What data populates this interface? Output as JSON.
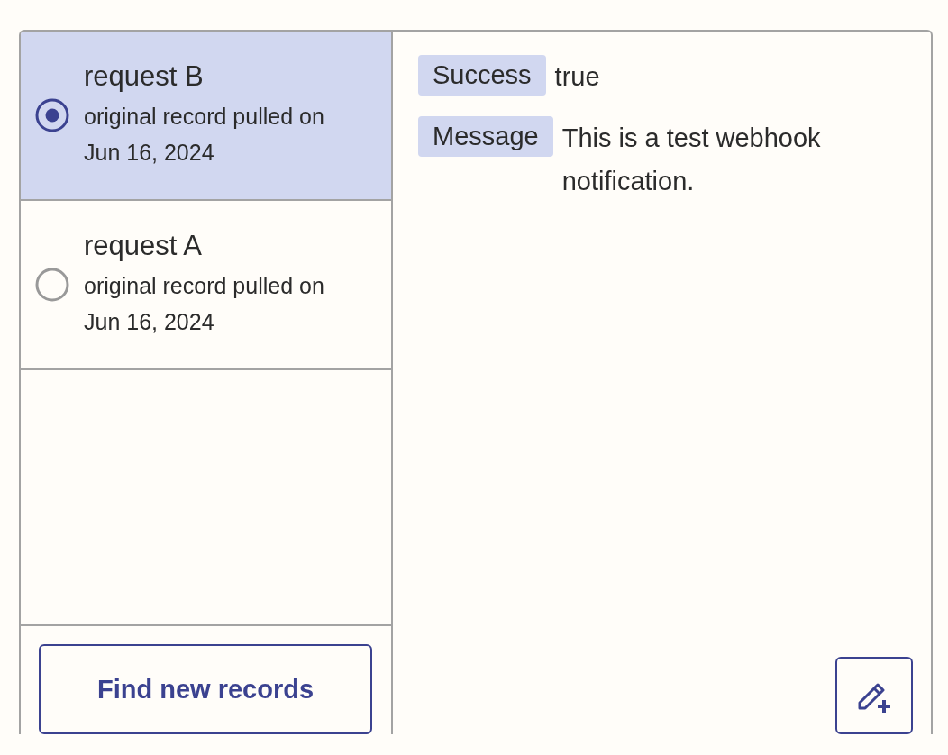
{
  "records": [
    {
      "title": "request B",
      "subtitle": "original record pulled on Jun 16, 2024",
      "selected": true
    },
    {
      "title": "request A",
      "subtitle": "original record pulled on Jun 16, 2024",
      "selected": false
    }
  ],
  "find_button": "Find new records",
  "fields": [
    {
      "label": "Success",
      "value": "true"
    },
    {
      "label": "Message",
      "value": "This is a test webhook notification."
    }
  ]
}
